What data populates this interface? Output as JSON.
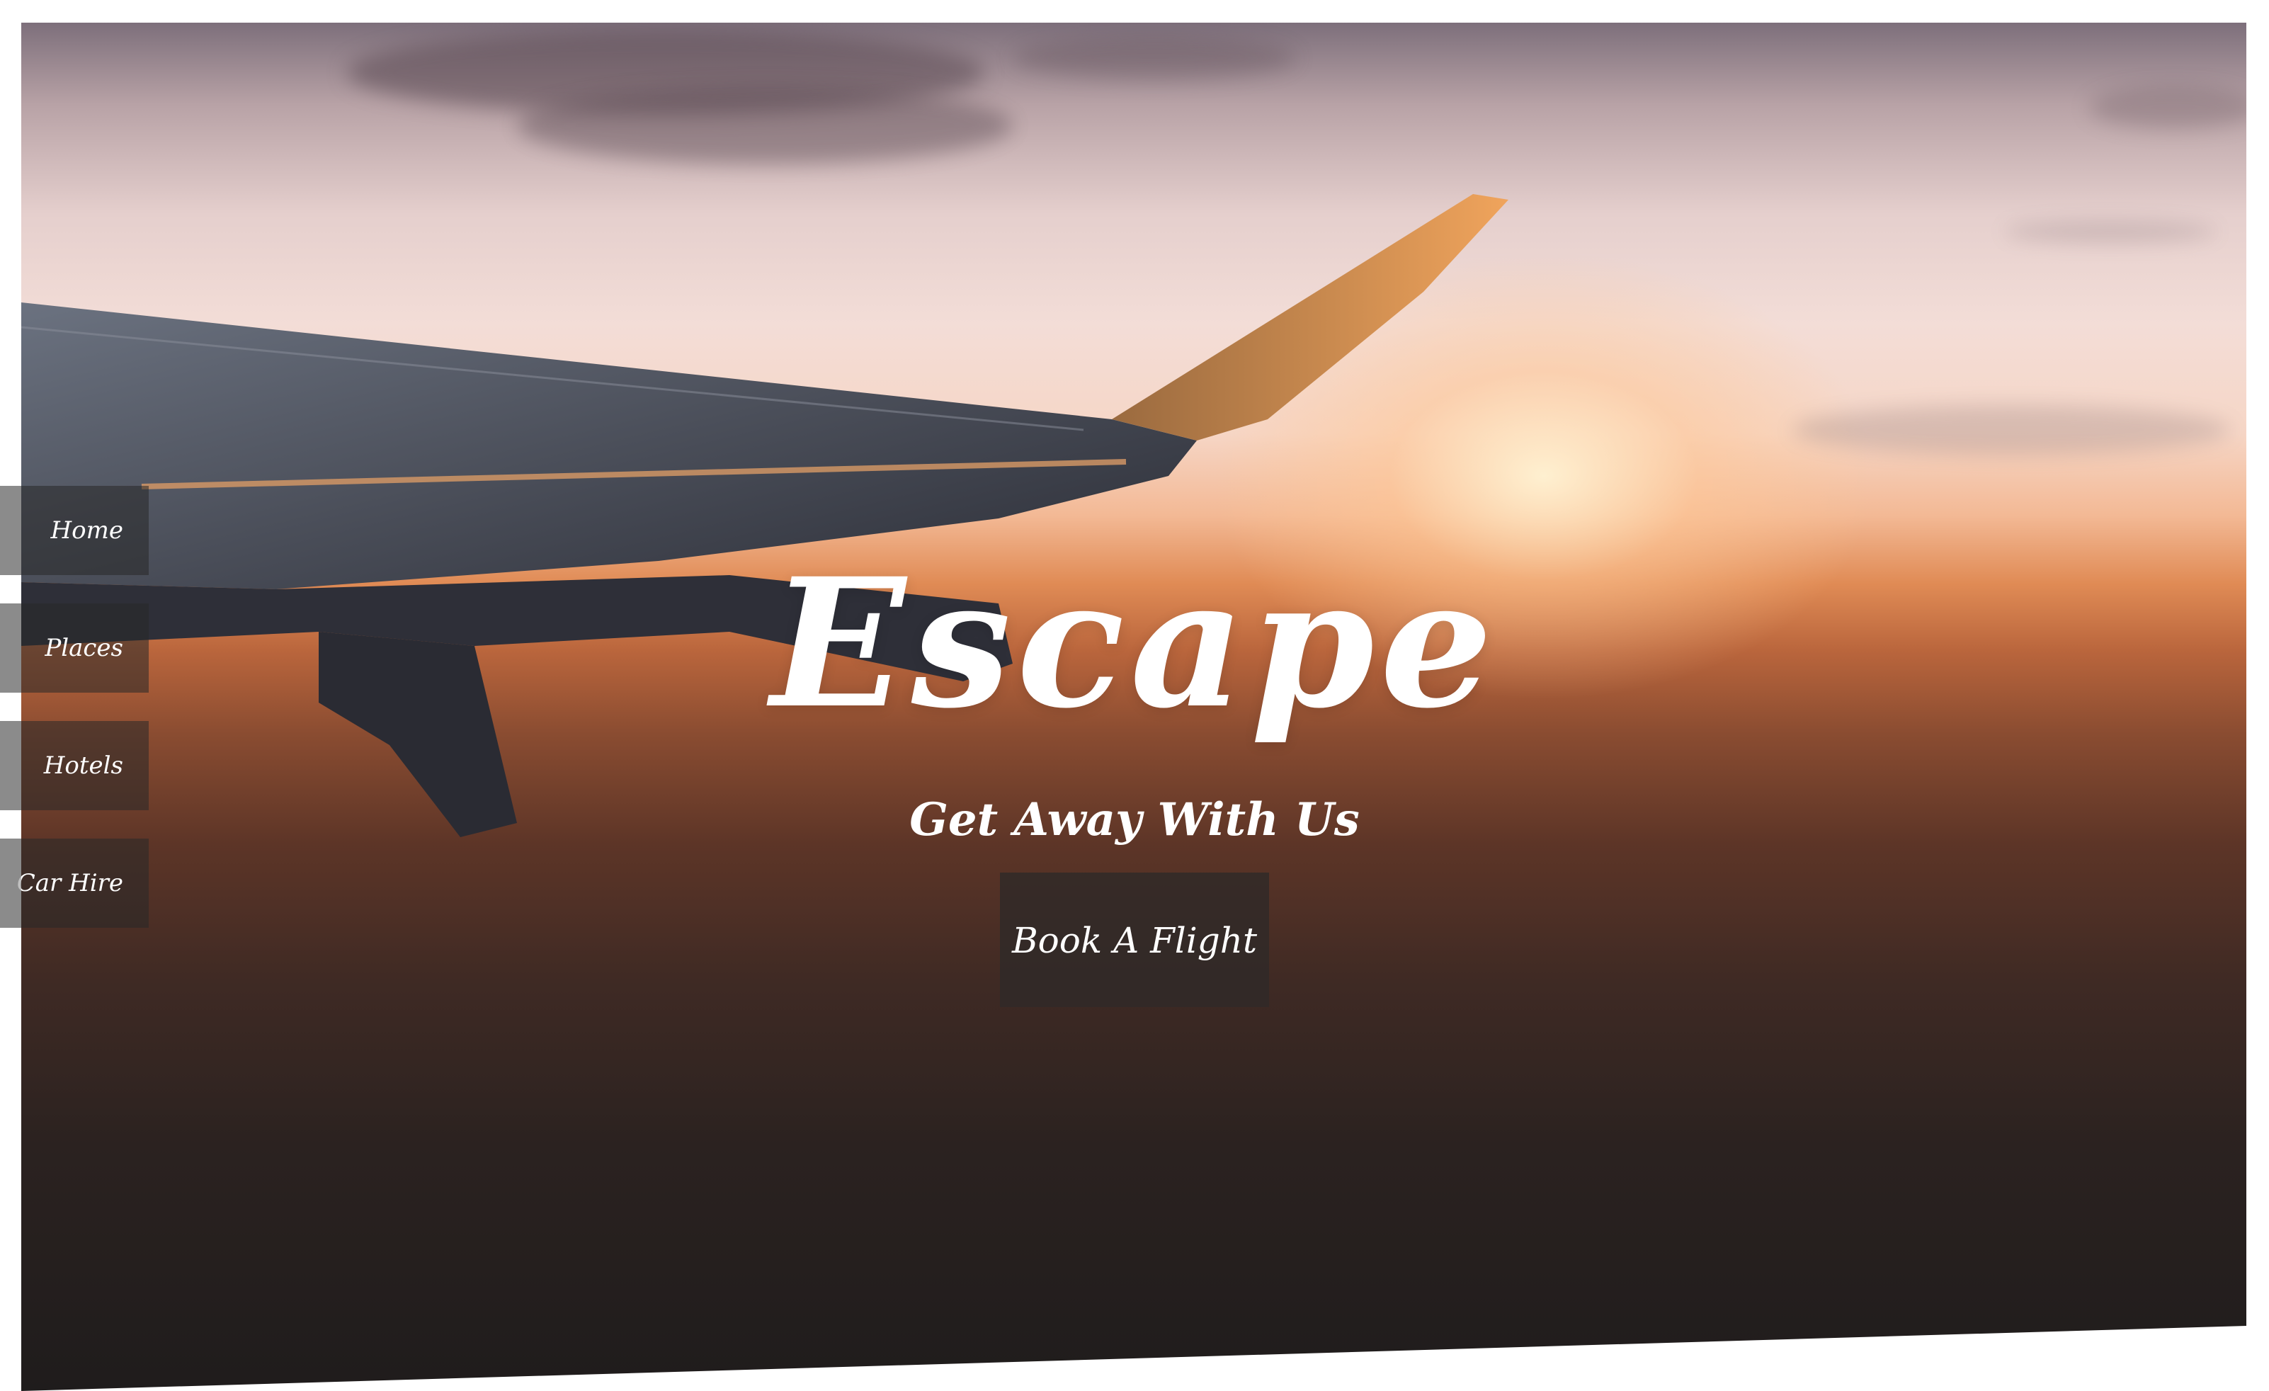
{
  "hero": {
    "title": "Escape",
    "subtitle": "Get Away With Us",
    "cta_label": "Book A Flight"
  },
  "nav": {
    "items": [
      {
        "label": "Home"
      },
      {
        "label": "Places"
      },
      {
        "label": "Hotels"
      },
      {
        "label": "Car Hire"
      }
    ]
  },
  "colors": {
    "text": "#ffffff",
    "nav_bg": "#282828",
    "button_bg": "#302a28",
    "sky_top": "#b8a2a6",
    "sunset": "#e08b55",
    "ground": "#1f1c1c"
  }
}
